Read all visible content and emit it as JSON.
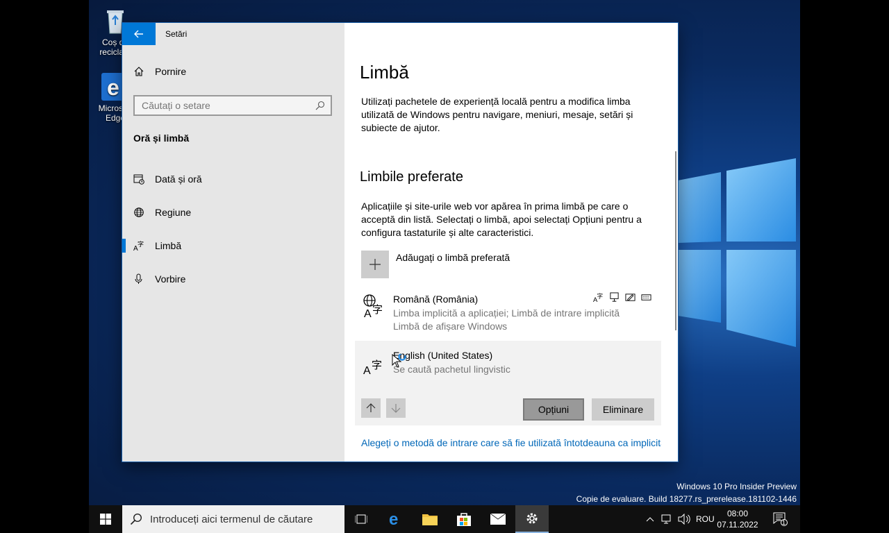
{
  "desktop": {
    "icons": [
      {
        "label": "Coș de reciclare",
        "icon": "recycle-bin-icon"
      },
      {
        "label": "Microsoft Edge",
        "icon": "edge-icon"
      }
    ],
    "watermark": {
      "line1": "Windows 10 Pro Insider Preview",
      "line2": "Copie de evaluare. Build 18277.rs_prerelease.181102-1446"
    }
  },
  "window": {
    "title": "Setări",
    "accent": "#0078d7",
    "sidebar": {
      "home_label": "Pornire",
      "search_placeholder": "Căutați o setare",
      "section_title": "Oră și limbă",
      "items": [
        {
          "label": "Dată și oră",
          "icon": "calendar-clock-icon",
          "selected": false
        },
        {
          "label": "Regiune",
          "icon": "globe-icon",
          "selected": false
        },
        {
          "label": "Limbă",
          "icon": "language-icon",
          "selected": true
        },
        {
          "label": "Vorbire",
          "icon": "microphone-icon",
          "selected": false
        }
      ]
    },
    "content": {
      "title": "Limbă",
      "intro": "Utilizați pachetele de experiență locală pentru a modifica limba utilizată de Windows pentru navigare, meniuri, mesaje, setări și subiecte de ajutor.",
      "preferred_title": "Limbile preferate",
      "preferred_desc": "Aplicațiile și site-urile web vor apărea în prima limbă pe care o acceptă din listă. Selectați o limbă, apoi selectați Opțiuni pentru a configura tastaturile și alte caracteristici.",
      "add_label": "Adăugați o limbă preferată",
      "languages": [
        {
          "name": "Română (România)",
          "desc_line1": "Limba implicită a aplicației; Limbă de intrare implicită",
          "desc_line2": "Limbă de afișare Windows"
        },
        {
          "name": "English (United States)",
          "desc_line1": "Se caută pachetul lingvistic"
        }
      ],
      "options_button": "Opțiuni",
      "remove_button": "Eliminare",
      "link": "Alegeți o metodă de intrare care să fie utilizată întotdeauna ca implicită"
    }
  },
  "taskbar": {
    "search_placeholder": "Introduceți aici termenul de căutare",
    "language": "ROU",
    "time": "08:00",
    "date": "07.11.2022",
    "notification_count": "1"
  }
}
